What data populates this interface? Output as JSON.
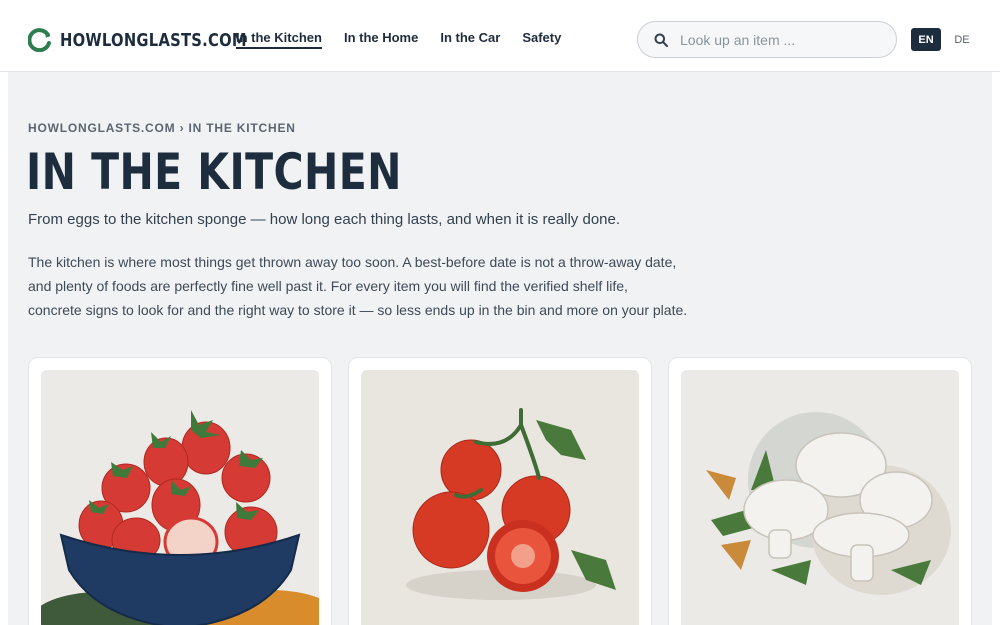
{
  "header": {
    "logo_text": "HOWLONGLASTS.COM",
    "nav": [
      {
        "label": "In the Kitchen",
        "active": true
      },
      {
        "label": "In the Home",
        "active": false
      },
      {
        "label": "In the Car",
        "active": false
      },
      {
        "label": "Safety",
        "active": false
      }
    ],
    "search": {
      "placeholder": "Look up an item ..."
    },
    "languages": [
      {
        "label": "EN",
        "active": true
      },
      {
        "label": "DE",
        "active": false
      }
    ]
  },
  "main": {
    "breadcrumb": "HOWLONGLASTS.COM › IN THE KITCHEN",
    "title": "IN THE KITCHEN",
    "subtitle": "From eggs to the kitchen sponge — how long each thing lasts, and when it is really done.",
    "intro_lines": [
      "The kitchen is where most things get thrown away too soon. A best-before date is not a throw-away date,",
      "and plenty of foods are perfectly fine well past it. For every item you will find the verified shelf life,",
      "concrete signs to look for and the right way to store it — so less ends up in the bin and more on your plate."
    ],
    "cards": [
      {
        "image": "strawberries-in-bowl"
      },
      {
        "image": "tomatoes-on-vine"
      },
      {
        "image": "mushrooms"
      }
    ]
  },
  "colors": {
    "brand": "#1e2d3d",
    "logo_green": "#2e7d4f",
    "page_bg": "#f1f2f4"
  }
}
